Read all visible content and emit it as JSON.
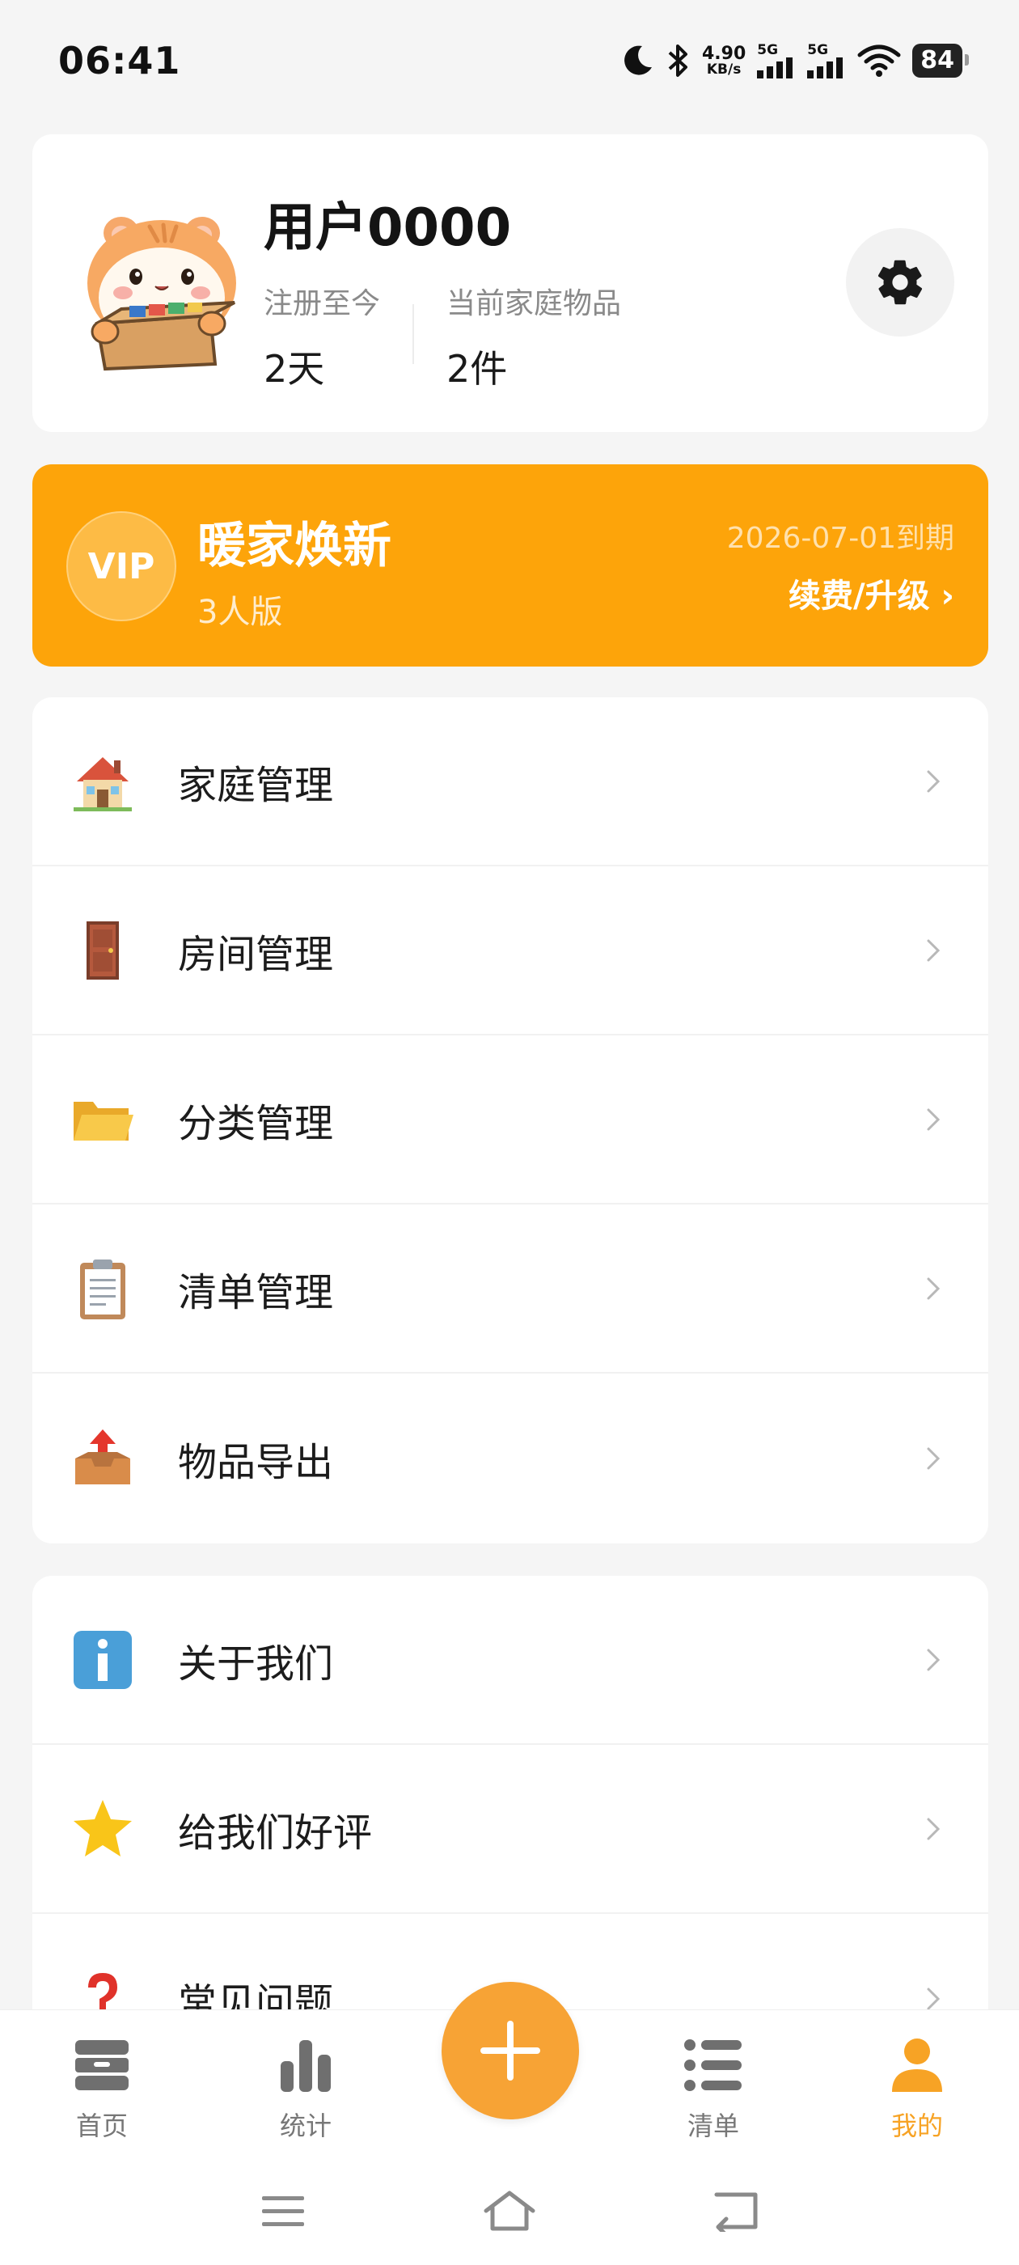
{
  "status_bar": {
    "time": "06:41",
    "net_speed_value": "4.90",
    "net_speed_unit": "KB/s",
    "sim1_label": "5G",
    "sim2_label": "5G",
    "battery": "84"
  },
  "profile": {
    "username": "用户0000",
    "registered_label": "注册至今",
    "registered_value": "2天",
    "items_label": "当前家庭物品",
    "items_value": "2件",
    "avatar_icon": "hamster-with-box-icon",
    "settings_icon": "gear-icon"
  },
  "vip": {
    "badge": "VIP",
    "title": "暖家焕新",
    "subtitle": "3人版",
    "expire": "2026-07-01到期",
    "renew": "续费/升级 ›",
    "color": "#fda40a"
  },
  "menu_group_1": [
    {
      "label": "家庭管理",
      "icon": "house-icon"
    },
    {
      "label": "房间管理",
      "icon": "door-icon"
    },
    {
      "label": "分类管理",
      "icon": "folder-icon"
    },
    {
      "label": "清单管理",
      "icon": "clipboard-icon"
    },
    {
      "label": "物品导出",
      "icon": "outbox-tray-icon"
    }
  ],
  "menu_group_2": [
    {
      "label": "关于我们",
      "icon": "info-icon"
    },
    {
      "label": "给我们好评",
      "icon": "star-icon"
    },
    {
      "label": "常见问题",
      "icon": "question-icon"
    }
  ],
  "tabbar": {
    "home": "首页",
    "stats": "统计",
    "list": "清单",
    "mine": "我的",
    "active": "mine",
    "accent": "#f7a325"
  }
}
